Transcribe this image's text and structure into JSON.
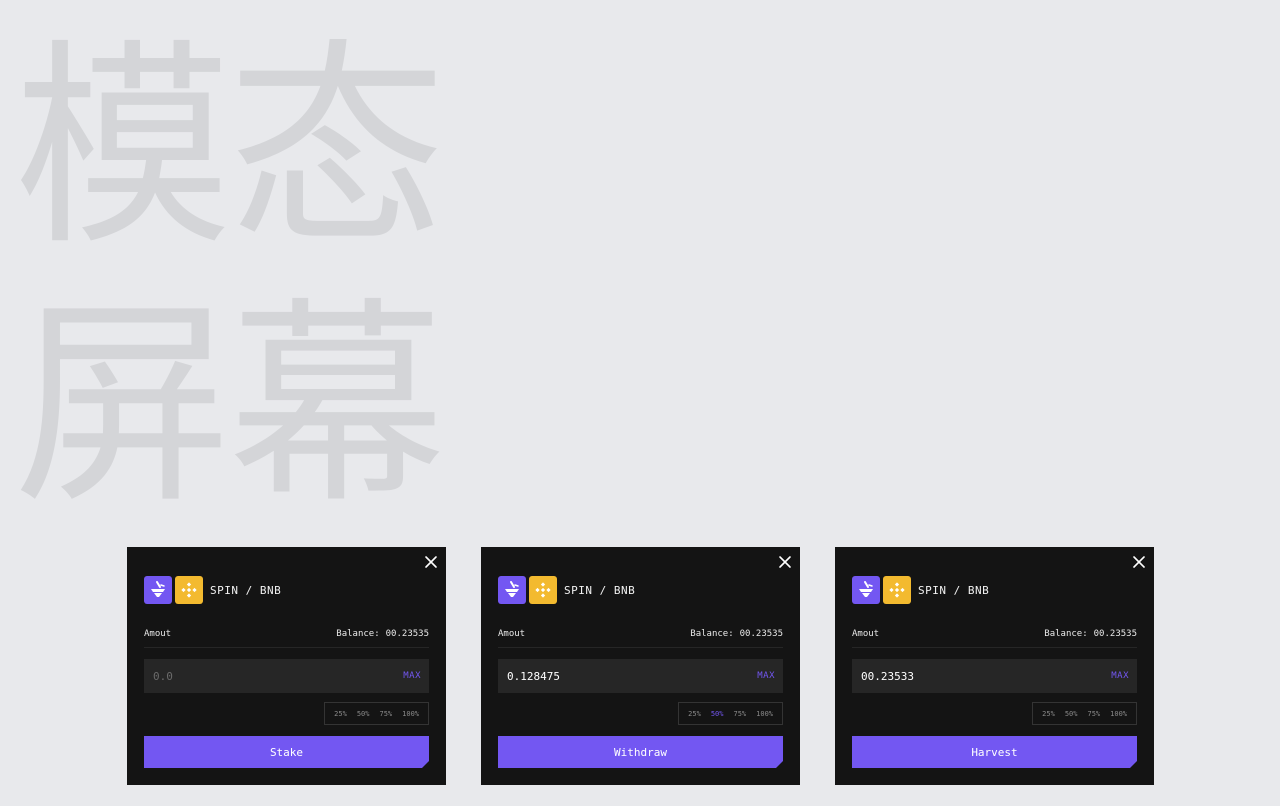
{
  "watermark": {
    "line1": "模态",
    "line2": "屏幕"
  },
  "colors": {
    "accent": "#7357f2",
    "bnb": "#f3ba2f",
    "modal_bg": "#141414",
    "input_bg": "#262626",
    "page_bg": "#e8e9ec"
  },
  "modals": [
    {
      "pair": "SPIN / BNB",
      "tokens": [
        "spin-icon",
        "bnb-icon"
      ],
      "amount_label": "Amout",
      "balance_label": "Balance:",
      "balance_value": "00.23535",
      "input_value": "",
      "input_placeholder": "0.0",
      "max_label": "MAX",
      "percent_options": [
        "25%",
        "50%",
        "75%",
        "100%"
      ],
      "active_percent": null,
      "action_label": "Stake"
    },
    {
      "pair": "SPIN / BNB",
      "tokens": [
        "spin-icon",
        "bnb-icon"
      ],
      "amount_label": "Amout",
      "balance_label": "Balance:",
      "balance_value": "00.23535",
      "input_value": "0.128475",
      "input_placeholder": "0.0",
      "max_label": "MAX",
      "percent_options": [
        "25%",
        "50%",
        "75%",
        "100%"
      ],
      "active_percent": "50%",
      "action_label": "Withdraw"
    },
    {
      "pair": "SPIN / BNB",
      "tokens": [
        "spin-icon",
        "bnb-icon"
      ],
      "amount_label": "Amout",
      "balance_label": "Balance:",
      "balance_value": "00.23535",
      "input_value": "00.23533",
      "input_placeholder": "0.0",
      "max_label": "MAX",
      "percent_options": [
        "25%",
        "50%",
        "75%",
        "100%"
      ],
      "active_percent": null,
      "action_label": "Harvest"
    }
  ]
}
